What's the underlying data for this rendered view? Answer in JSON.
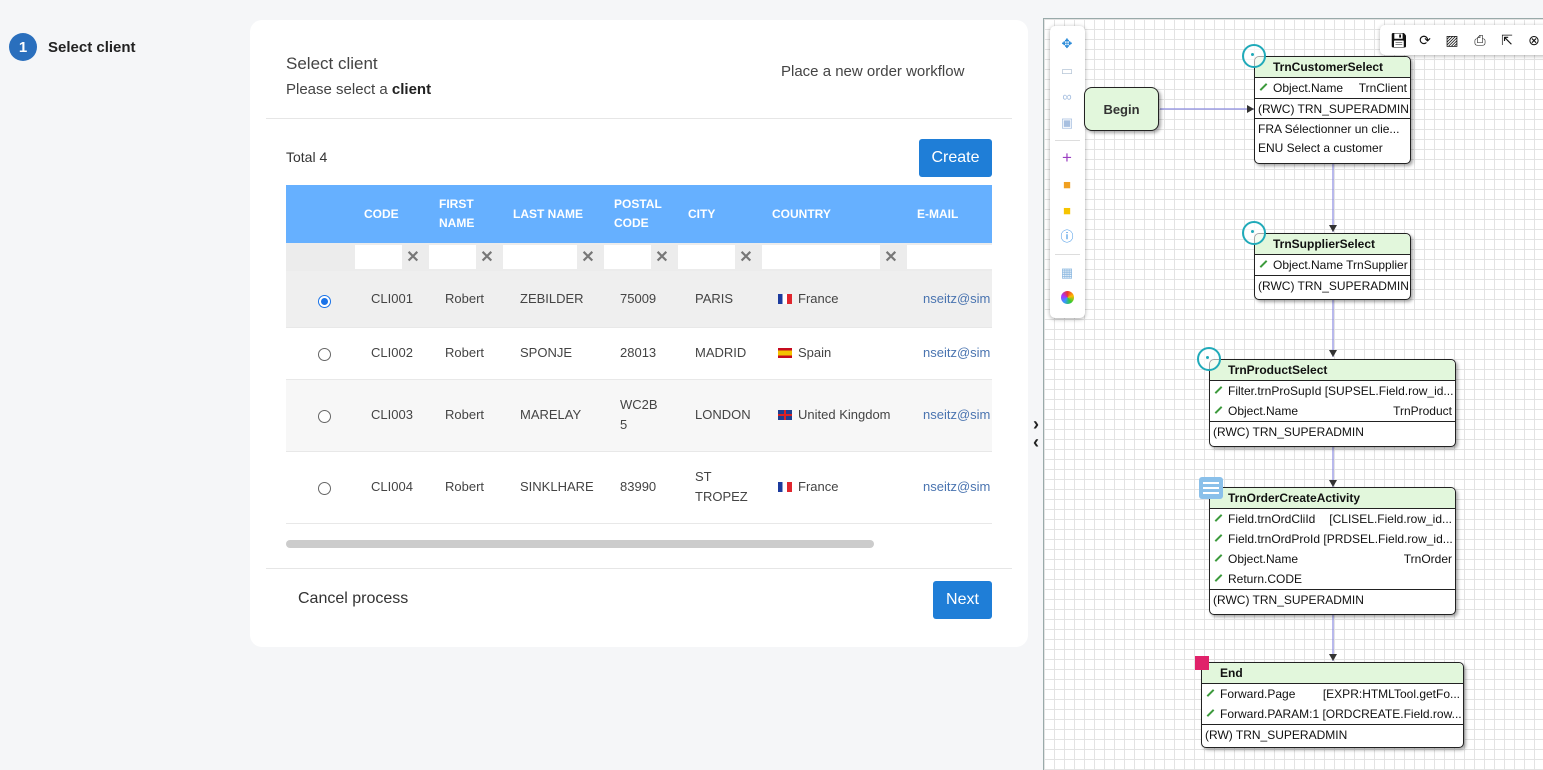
{
  "stepper": {
    "number": "1",
    "label": "Select client"
  },
  "card": {
    "title": "Select client",
    "subtitle_prefix": "Please select a ",
    "subtitle_bold": "client",
    "workflow_label": "Place a new order workflow",
    "total": "Total 4",
    "create_label": "Create",
    "cancel_label": "Cancel process",
    "next_label": "Next"
  },
  "table": {
    "columns": [
      "CODE",
      "FIRST NAME",
      "LAST NAME",
      "POSTAL CODE",
      "CITY",
      "COUNTRY",
      "E-MAIL"
    ],
    "rows": [
      {
        "selected": true,
        "code": "CLI001",
        "first": "Robert",
        "last": "ZEBILDER",
        "postal": "75009",
        "city": "PARIS",
        "country": "France",
        "flag": "fr",
        "email": "nseitz@sim"
      },
      {
        "selected": false,
        "code": "CLI002",
        "first": "Robert",
        "last": "SPONJE",
        "postal": "28013",
        "city": "MADRID",
        "country": "Spain",
        "flag": "es",
        "email": "nseitz@sim"
      },
      {
        "selected": false,
        "code": "CLI003",
        "first": "Robert",
        "last": "MARELAY",
        "postal": "WC2B 5",
        "city": "LONDON",
        "country": "United Kingdom",
        "flag": "gb",
        "email": "nseitz@sim"
      },
      {
        "selected": false,
        "code": "CLI004",
        "first": "Robert",
        "last": "SINKLHARE",
        "postal": "83990",
        "city": "ST TROPEZ",
        "country": "France",
        "flag": "fr",
        "email": "nseitz@sim"
      }
    ]
  },
  "designer": {
    "palette_icons": [
      "move-icon",
      "select-area-icon",
      "link-icon",
      "group-icon",
      "add-icon",
      "note-orange-icon",
      "note-yellow-icon",
      "info-icon",
      "grid-icon",
      "color-wheel-icon"
    ],
    "toolbar_icons": [
      "save-icon",
      "refresh-icon",
      "image-icon",
      "print-icon",
      "external-link-icon",
      "close-icon"
    ],
    "begin_label": "Begin",
    "nodes": {
      "customer": {
        "title": "TrnCustomerSelect",
        "line1": "Object.Name",
        "line1_val": "TrnClient",
        "line2": "(RWC) TRN_SUPERADMIN",
        "line3": "FRA Sélectionner un clie...",
        "line4": "ENU Select a customer"
      },
      "supplier": {
        "title": "TrnSupplierSelect",
        "line1": "Object.Name TrnSupplier",
        "line2": "(RWC) TRN_SUPERADMIN"
      },
      "product": {
        "title": "TrnProductSelect",
        "line1": "Filter.trnProSupId [SUPSEL.Field.row_id...",
        "line2": "Object.Name",
        "line2_val": "TrnProduct",
        "line3": "(RWC) TRN_SUPERADMIN"
      },
      "order": {
        "title": "TrnOrderCreateActivity",
        "line1": "Field.trnOrdCliId",
        "line1_val": "[CLISEL.Field.row_id...",
        "line2": "Field.trnOrdProId [PRDSEL.Field.row_id...",
        "line3": "Object.Name",
        "line3_val": "TrnOrder",
        "line4": "Return.CODE",
        "line5": "(RWC) TRN_SUPERADMIN"
      },
      "end": {
        "title": "End",
        "line1": "Forward.Page",
        "line1_val": "[EXPR:HTMLTool.getFo...",
        "line2": "Forward.PARAM:1 [ORDCREATE.Field.row...",
        "line3": "(RW) TRN_SUPERADMIN"
      }
    }
  }
}
